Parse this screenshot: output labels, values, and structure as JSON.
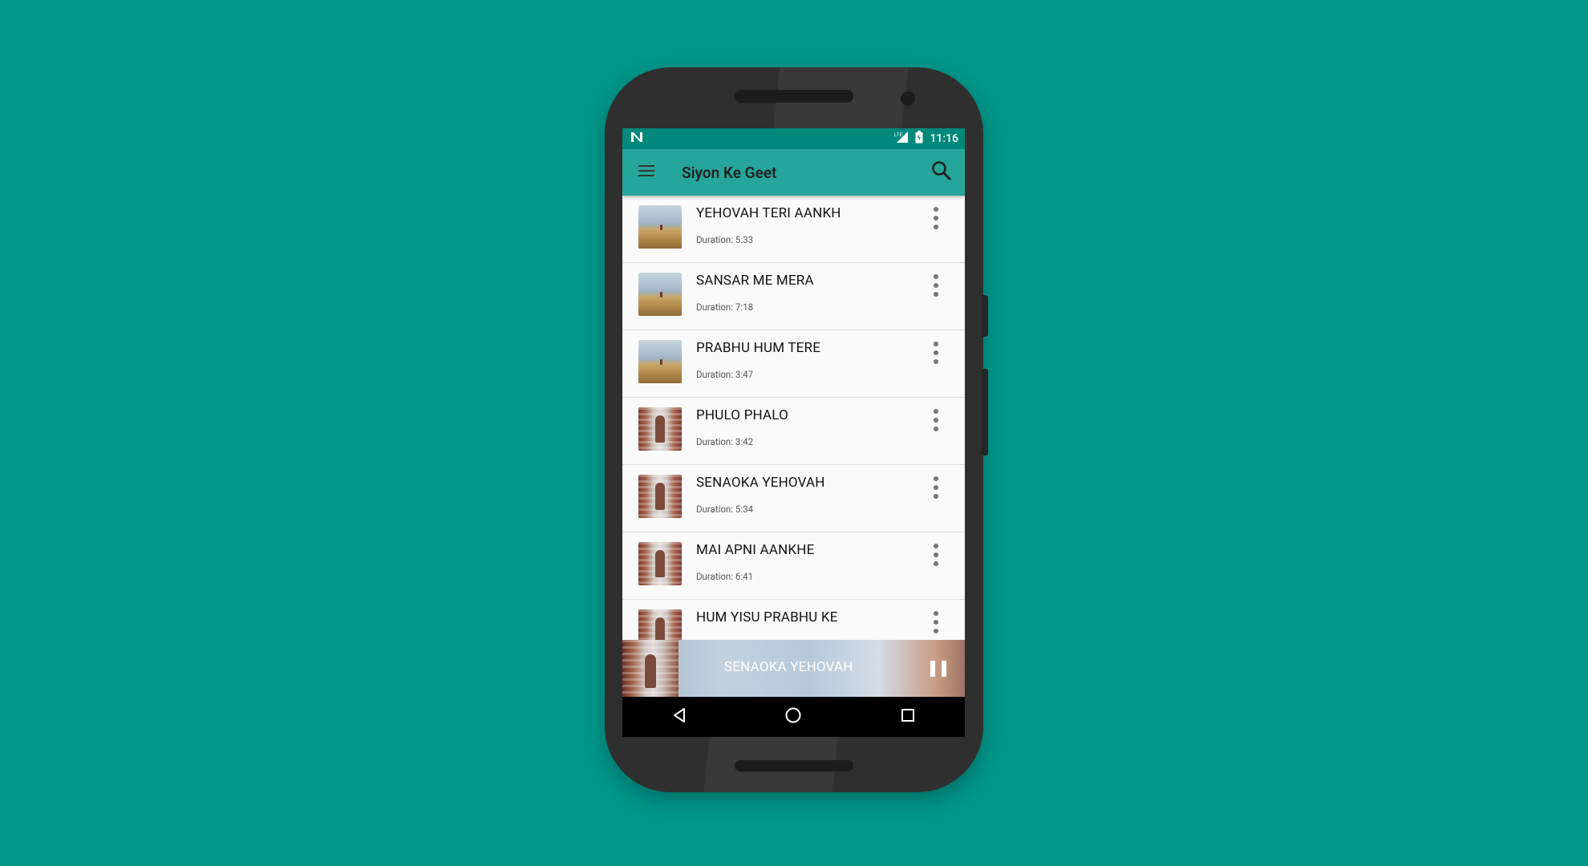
{
  "status_bar": {
    "notification_icon": "n-notification-icon",
    "network_label": "LTE",
    "time": "11:16"
  },
  "app_bar": {
    "title": "Siyon Ke Geet",
    "menu_icon": "hamburger-menu-icon",
    "search_icon": "search-icon"
  },
  "songs": [
    {
      "title": "YEHOVAH TERI AANKH",
      "duration": "Duration: 5:33",
      "thumb": "landscape"
    },
    {
      "title": "SANSAR ME MERA",
      "duration": "Duration: 7:18",
      "thumb": "landscape"
    },
    {
      "title": "PRABHU HUM TERE",
      "duration": "Duration: 3:47",
      "thumb": "landscape"
    },
    {
      "title": "PHULO PHALO",
      "duration": "Duration: 3:42",
      "thumb": "stairs"
    },
    {
      "title": "SENAOKA YEHOVAH",
      "duration": "Duration: 5:34",
      "thumb": "stairs"
    },
    {
      "title": "MAI APNI AANKHE",
      "duration": "Duration: 6:41",
      "thumb": "stairs"
    },
    {
      "title": "HUM YISU PRABHU KE",
      "duration": "",
      "thumb": "stairs"
    }
  ],
  "player": {
    "now_playing": "SENAOKA YEHOVAH",
    "control_icon": "pause-icon"
  },
  "colors": {
    "background": "#009688",
    "status_bar": "#00897b",
    "app_bar": "#26a69a",
    "navbar": "#000000"
  }
}
